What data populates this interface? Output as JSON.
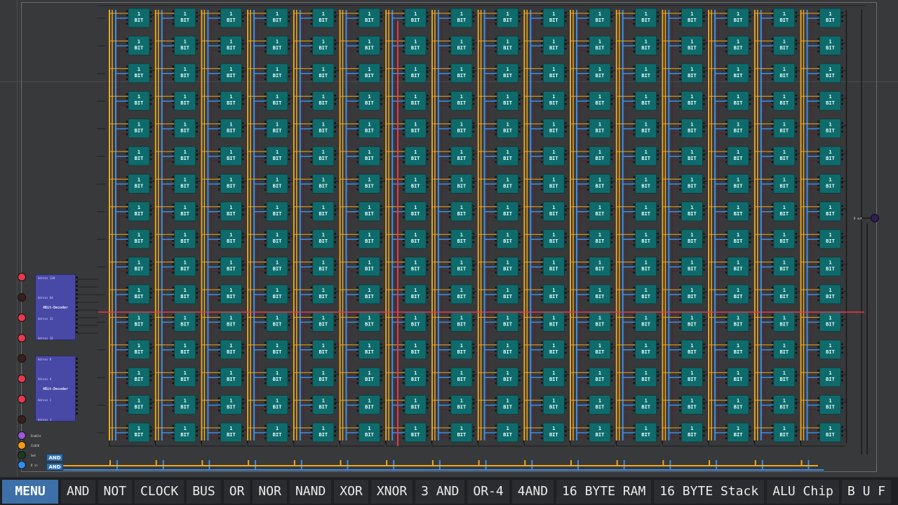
{
  "grid": {
    "columns": 16,
    "rows": 16,
    "cell_label_top": "1",
    "cell_label_bottom": "BIT"
  },
  "decoders": [
    {
      "title": "4Bit-Decoder",
      "pins": [
        "Adress 128",
        "Adress 64",
        "Adress 32",
        "Adress 16"
      ]
    },
    {
      "title": "4Bit-Decoder",
      "pins": [
        "Adress 8",
        "Adress 4",
        "Adress 2",
        "Adress 1"
      ]
    }
  ],
  "inputs": [
    {
      "name": "addr-128",
      "color": "#e8384f"
    },
    {
      "name": "addr-64",
      "color": "#3a1e1e"
    },
    {
      "name": "addr-32",
      "color": "#e8384f"
    },
    {
      "name": "addr-16",
      "color": "#e8384f"
    },
    {
      "name": "addr-8",
      "color": "#3a1e1e"
    },
    {
      "name": "addr-4",
      "color": "#e8384f"
    },
    {
      "name": "addr-2",
      "color": "#e8384f"
    },
    {
      "name": "addr-1",
      "color": "#3a1e1e"
    }
  ],
  "controls": [
    {
      "label": "Enable",
      "color": "#9b59d6"
    },
    {
      "label": "CLOCK",
      "color": "#f39c12"
    },
    {
      "label": "Set",
      "color": "#1e3a1e"
    },
    {
      "label": "D in",
      "color": "#2d8cf0"
    }
  ],
  "and_gates": [
    "AND",
    "AND"
  ],
  "output": {
    "label": "D out"
  },
  "colors": {
    "cell": "#0f6b6b",
    "wire_orange": "#f0a81e",
    "wire_blue": "#3d8ee6",
    "wire_red": "#e8384f",
    "wire_dark": "#5a1f2a",
    "decoder": "#4848a6"
  },
  "toolbar": {
    "menu": "MENU",
    "items": [
      "AND",
      "NOT",
      "CLOCK",
      "BUS",
      "OR",
      "NOR",
      "NAND",
      "XOR",
      "XNOR",
      "3 AND",
      "OR-4",
      "4AND",
      "16 BYTE RAM",
      "16 BYTE Stack",
      "ALU Chip",
      "B U F"
    ]
  }
}
